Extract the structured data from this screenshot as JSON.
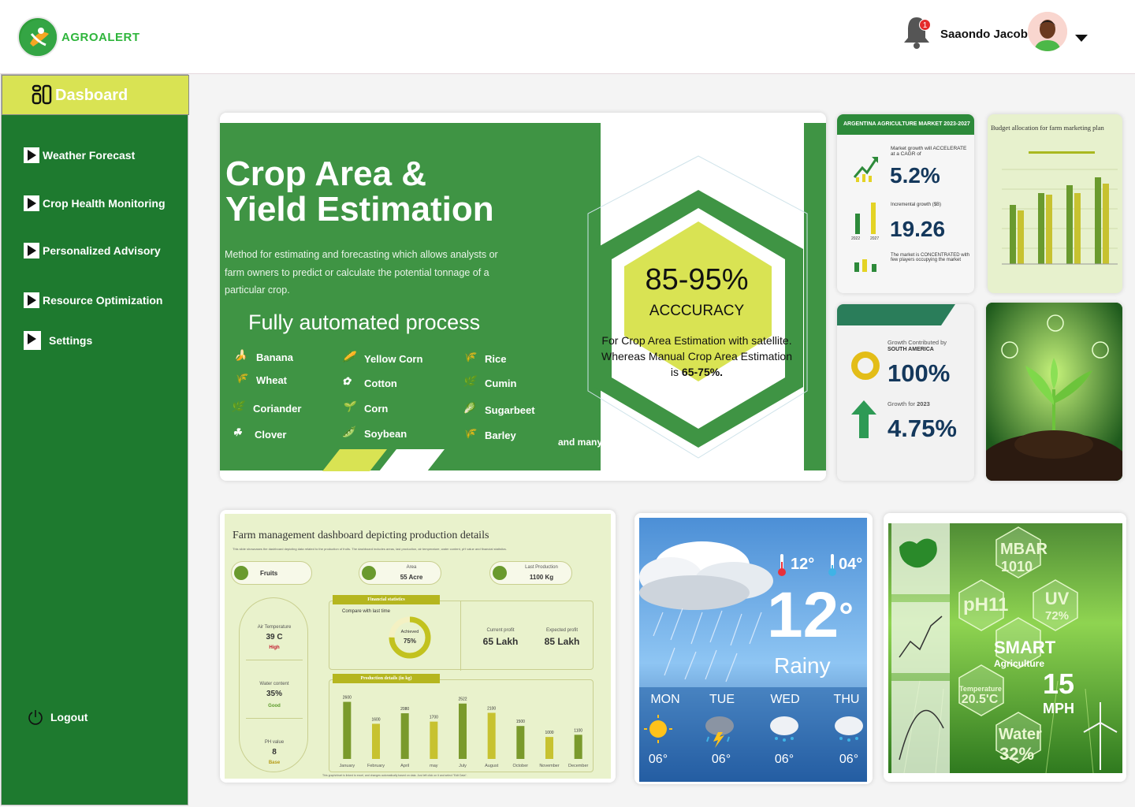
{
  "app": {
    "brand": "AGROALERT"
  },
  "header": {
    "username": "Saaondo Jacob",
    "notification_count": "1"
  },
  "sidebar": {
    "dashboard_label": "Dasboard",
    "items": [
      {
        "label": "Weather Forecast"
      },
      {
        "label": "Crop Health Monitoring"
      },
      {
        "label": "Personalized Advisory"
      },
      {
        "label": "Resource Optimization"
      },
      {
        "label": "Settings"
      }
    ],
    "logout_label": "Logout"
  },
  "crop_card": {
    "title_line1": "Crop Area &",
    "title_line2": "Yield Estimation",
    "description": "Method for estimating and forecasting which allows analysts or farm owners to predict or calculate the potential tonnage of a particular crop.",
    "subtitle": "Fully automated process",
    "crops": [
      "Banana",
      "Wheat",
      "Coriander",
      "Clover",
      "Yellow Corn",
      "Cotton",
      "Corn",
      "Soybean",
      "Rice",
      "Cumin",
      "Sugarbeet",
      "Barley"
    ],
    "more": "and many more",
    "accuracy_value": "85-95%",
    "accuracy_label": "ACCCURACY",
    "accuracy_desc_1": "For Crop Area Estimation with satellite. Whereas Manual Crop Area Estimation is",
    "accuracy_desc_2": "65-75%."
  },
  "argentina_card": {
    "title": "ARGENTINA AGRICULTURE MARKET 2023-2027",
    "growth_text": "Market growth will ACCELERATE at a CAGR of",
    "cagr": "5.2%",
    "incremental_label": "Incremental growth ($B)",
    "incremental": "19.26",
    "concentrated": "The market is CONCENTRATED with few players occupying the market",
    "year_a": "2022",
    "year_b": "2027"
  },
  "budget_card": {
    "title": "Budget allocation for farm marketing plan"
  },
  "growth_card": {
    "contributed_label": "Growth Contributed by",
    "region": "SOUTH AMERICA",
    "contributed_value": "100%",
    "growth_for_label": "Growth for",
    "growth_year": "2023",
    "growth_value": "4.75%"
  },
  "farm_card": {
    "title": "Farm management dashboard depicting production details",
    "subtitle": "This slide showcases the dashboard depicting data related to the production of fruits. The dashboard includes areas, last production, air temperature, water content, pH value and financial statistics.",
    "pill_fruits": "Fruits",
    "area_label": "Area",
    "area_value": "55 Acre",
    "last_prod_label": "Last Production",
    "last_prod_value": "1100 Kg",
    "air_label": "Air Temperature",
    "air_value": "39 C",
    "air_status": "High",
    "water_label": "Water content",
    "water_value": "35%",
    "water_status": "Good",
    "ph_label": "PH value",
    "ph_value": "8",
    "ph_status": "Base",
    "fin_title": "Financial statistics",
    "compare_label": "Compare with last time",
    "achieved_label": "Achieved",
    "achieved_value": "75%",
    "current_label": "Current profit",
    "current_value": "65 Lakh",
    "expected_label": "Expected profit",
    "expected_value": "85 Lakh",
    "prod_title": "Production details (in kg)",
    "footer": "This graph/chart is linked to excel, and changes automatically based on data. Just left click on it and select \"Edit Data\"."
  },
  "chart_data": {
    "type": "bar",
    "title": "Production details (in kg)",
    "categories": [
      "January",
      "February",
      "April",
      "may",
      "July",
      "August",
      "October",
      "November",
      "December"
    ],
    "values": [
      2600,
      1600,
      2080,
      1700,
      2522,
      2100,
      1500,
      1000,
      1100
    ],
    "ylim": [
      0,
      2800
    ]
  },
  "weather": {
    "high": "12",
    "low": "04",
    "current_temp": "12",
    "condition": "Rainy",
    "days": [
      {
        "day": "MON",
        "temp": "06"
      },
      {
        "day": "TUE",
        "temp": "06"
      },
      {
        "day": "WED",
        "temp": "06"
      },
      {
        "day": "THU",
        "temp": "06"
      }
    ]
  },
  "smart_card": {
    "mbar": "MBAR",
    "mbar_val": "1010",
    "ph": "pH11",
    "uv": "UV",
    "uv_val": "72%",
    "smart": "SMART",
    "agri": "Agriculture",
    "temp_label": "Temperature",
    "temp_val": "20.5'C",
    "speed": "15",
    "speed_unit": "MPH",
    "water": "Water",
    "water_val": "32%"
  },
  "colors": {
    "sidebar": "#1e7a2f",
    "accent": "#d9e353",
    "brand": "#2fb53c"
  }
}
